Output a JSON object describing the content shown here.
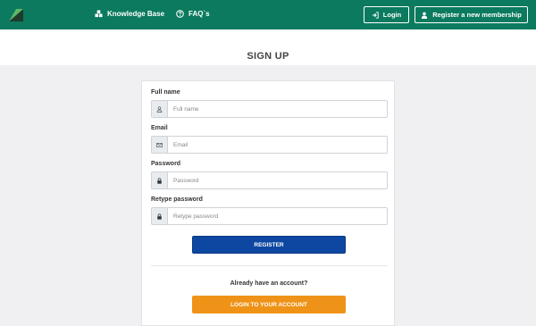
{
  "header": {
    "logo_icon": "logo-icon",
    "nav": [
      {
        "label": "Knowledge Base",
        "icon": "cubes-icon"
      },
      {
        "label": "FAQ`s",
        "icon": "question-circle-icon"
      }
    ],
    "login_label": "Login",
    "register_label": "Register a new membership",
    "colors": {
      "bar": "#0b7a5e",
      "text": "#ffffff"
    }
  },
  "page": {
    "title": "SIGN UP"
  },
  "form": {
    "fields": [
      {
        "label": "Full name",
        "placeholder": "Full name",
        "icon": "user-icon"
      },
      {
        "label": "Email",
        "placeholder": "Email",
        "icon": "envelope-icon"
      },
      {
        "label": "Password",
        "placeholder": "Password",
        "icon": "lock-icon"
      },
      {
        "label": "Retype password",
        "placeholder": "Retype password",
        "icon": "lock-icon"
      }
    ],
    "register_label": "REGISTER",
    "already_text": "Already have an account?",
    "login_account_label": "LOGIN TO YOUR ACCOUNT",
    "colors": {
      "register": "#0d47a1",
      "login": "#ef9318"
    }
  }
}
